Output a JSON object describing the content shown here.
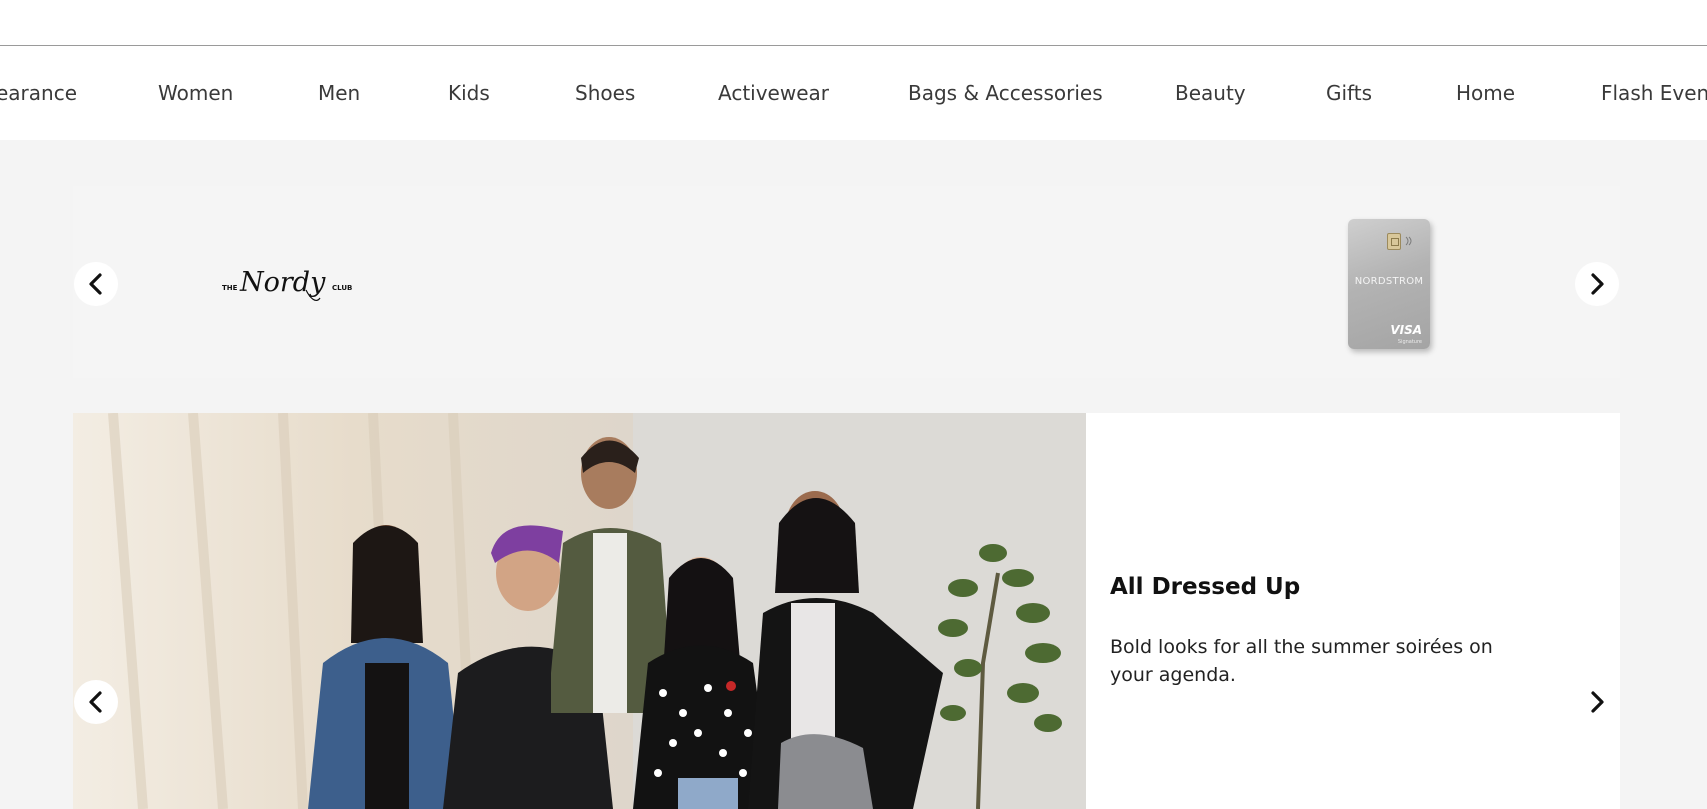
{
  "nav": {
    "items": [
      {
        "label": "earance"
      },
      {
        "label": "Women"
      },
      {
        "label": "Men"
      },
      {
        "label": "Kids"
      },
      {
        "label": "Shoes"
      },
      {
        "label": "Activewear"
      },
      {
        "label": "Bags & Accessories"
      },
      {
        "label": "Beauty"
      },
      {
        "label": "Gifts"
      },
      {
        "label": "Home"
      },
      {
        "label": "Flash Events"
      }
    ]
  },
  "promo": {
    "logo_text_small_left": "THE",
    "logo_text_script": "Nordy",
    "logo_text_small_right": "CLUB",
    "card_brand": "NORDSTROM",
    "card_network": "VISA",
    "card_network_sub": "Signature",
    "prev_icon": "chevron-left-icon",
    "next_icon": "chevron-right-icon"
  },
  "feature": {
    "title": "All Dressed Up",
    "text": "Bold looks for all the summer soirées on your agenda.",
    "prev_icon": "chevron-left-icon",
    "next_icon": "chevron-right-icon"
  },
  "colors": {
    "page_background": "#f4f4f4",
    "nav_background": "#ffffff",
    "text": "#3a3a3a"
  }
}
